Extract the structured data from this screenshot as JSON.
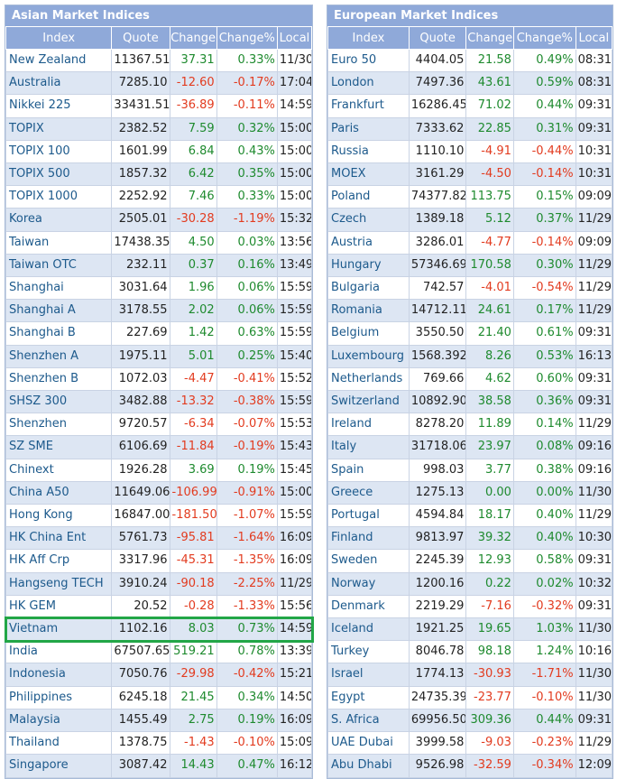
{
  "asian": {
    "title": "Asian Market Indices",
    "headers": [
      "Index",
      "Quote",
      "Change",
      "Change%",
      "Local"
    ],
    "rows": [
      [
        "New Zealand",
        "11367.51",
        "37.31",
        "0.33%",
        "11/30"
      ],
      [
        "Australia",
        "7285.10",
        "-12.60",
        "-0.17%",
        "17:04"
      ],
      [
        "Nikkei 225",
        "33431.51",
        "-36.89",
        "-0.11%",
        "14:59"
      ],
      [
        "TOPIX",
        "2382.52",
        "7.59",
        "0.32%",
        "15:00"
      ],
      [
        "TOPIX 100",
        "1601.99",
        "6.84",
        "0.43%",
        "15:00"
      ],
      [
        "TOPIX 500",
        "1857.32",
        "6.42",
        "0.35%",
        "15:00"
      ],
      [
        "TOPIX 1000",
        "2252.92",
        "7.46",
        "0.33%",
        "15:00"
      ],
      [
        "Korea",
        "2505.01",
        "-30.28",
        "-1.19%",
        "15:32"
      ],
      [
        "Taiwan",
        "17438.35",
        "4.50",
        "0.03%",
        "13:56"
      ],
      [
        "Taiwan OTC",
        "232.11",
        "0.37",
        "0.16%",
        "13:49"
      ],
      [
        "Shanghai",
        "3031.64",
        "1.96",
        "0.06%",
        "15:59"
      ],
      [
        "Shanghai A",
        "3178.55",
        "2.02",
        "0.06%",
        "15:59"
      ],
      [
        "Shanghai B",
        "227.69",
        "1.42",
        "0.63%",
        "15:59"
      ],
      [
        "Shenzhen A",
        "1975.11",
        "5.01",
        "0.25%",
        "15:40"
      ],
      [
        "Shenzhen B",
        "1072.03",
        "-4.47",
        "-0.41%",
        "15:52"
      ],
      [
        "SHSZ 300",
        "3482.88",
        "-13.32",
        "-0.38%",
        "15:59"
      ],
      [
        "Shenzhen",
        "9720.57",
        "-6.34",
        "-0.07%",
        "15:53"
      ],
      [
        "SZ SME",
        "6106.69",
        "-11.84",
        "-0.19%",
        "15:43"
      ],
      [
        "Chinext",
        "1926.28",
        "3.69",
        "0.19%",
        "15:45"
      ],
      [
        "China A50",
        "11649.06",
        "-106.99",
        "-0.91%",
        "15:00"
      ],
      [
        "Hong Kong",
        "16847.00",
        "-181.50",
        "-1.07%",
        "15:59"
      ],
      [
        "HK China Ent",
        "5761.73",
        "-95.81",
        "-1.64%",
        "16:09"
      ],
      [
        "HK Aff Crp",
        "3317.96",
        "-45.31",
        "-1.35%",
        "16:09"
      ],
      [
        "Hangseng TECH",
        "3910.24",
        "-90.18",
        "-2.25%",
        "11/29"
      ],
      [
        "HK GEM",
        "20.52",
        "-0.28",
        "-1.33%",
        "15:56"
      ],
      [
        "Vietnam",
        "1102.16",
        "8.03",
        "0.73%",
        "14:59"
      ],
      [
        "India",
        "67507.65",
        "519.21",
        "0.78%",
        "13:39"
      ],
      [
        "Indonesia",
        "7050.76",
        "-29.98",
        "-0.42%",
        "15:21"
      ],
      [
        "Philippines",
        "6245.18",
        "21.45",
        "0.34%",
        "14:50"
      ],
      [
        "Malaysia",
        "1455.49",
        "2.75",
        "0.19%",
        "16:09"
      ],
      [
        "Thailand",
        "1378.75",
        "-1.43",
        "-0.10%",
        "15:09"
      ],
      [
        "Singapore",
        "3087.42",
        "14.43",
        "0.47%",
        "16:12"
      ]
    ]
  },
  "european": {
    "title": "European Market Indices",
    "headers": [
      "Index",
      "Quote",
      "Change",
      "Change%",
      "Local"
    ],
    "rows": [
      [
        "Euro 50",
        "4404.05",
        "21.58",
        "0.49%",
        "08:31"
      ],
      [
        "London",
        "7497.36",
        "43.61",
        "0.59%",
        "08:31"
      ],
      [
        "Frankfurt",
        "16286.45",
        "71.02",
        "0.44%",
        "09:31"
      ],
      [
        "Paris",
        "7333.62",
        "22.85",
        "0.31%",
        "09:31"
      ],
      [
        "Russia",
        "1110.10",
        "-4.91",
        "-0.44%",
        "10:31"
      ],
      [
        "MOEX",
        "3161.29",
        "-4.50",
        "-0.14%",
        "10:31"
      ],
      [
        "Poland",
        "74377.82",
        "113.75",
        "0.15%",
        "09:09"
      ],
      [
        "Czech",
        "1389.18",
        "5.12",
        "0.37%",
        "11/29"
      ],
      [
        "Austria",
        "3286.01",
        "-4.77",
        "-0.14%",
        "09:09"
      ],
      [
        "Hungary",
        "57346.69",
        "170.58",
        "0.30%",
        "11/29"
      ],
      [
        "Bulgaria",
        "742.57",
        "-4.01",
        "-0.54%",
        "11/29"
      ],
      [
        "Romania",
        "14712.11",
        "24.61",
        "0.17%",
        "11/29"
      ],
      [
        "Belgium",
        "3550.50",
        "21.40",
        "0.61%",
        "09:31"
      ],
      [
        "Luxembourg",
        "1568.392",
        "8.26",
        "0.53%",
        "16:13"
      ],
      [
        "Netherlands",
        "769.66",
        "4.62",
        "0.60%",
        "09:31"
      ],
      [
        "Switzerland",
        "10892.90",
        "38.58",
        "0.36%",
        "09:31"
      ],
      [
        "Ireland",
        "8278.20",
        "11.89",
        "0.14%",
        "11/29"
      ],
      [
        "Italy",
        "31718.06",
        "23.97",
        "0.08%",
        "09:16"
      ],
      [
        "Spain",
        "998.03",
        "3.77",
        "0.38%",
        "09:16"
      ],
      [
        "Greece",
        "1275.13",
        "0.00",
        "0.00%",
        "11/30"
      ],
      [
        "Portugal",
        "4594.84",
        "18.17",
        "0.40%",
        "11/29"
      ],
      [
        "Finland",
        "9813.97",
        "39.32",
        "0.40%",
        "10:30"
      ],
      [
        "Sweden",
        "2245.39",
        "12.93",
        "0.58%",
        "09:31"
      ],
      [
        "Norway",
        "1200.16",
        "0.22",
        "0.02%",
        "10:32"
      ],
      [
        "Denmark",
        "2219.29",
        "-7.16",
        "-0.32%",
        "09:31"
      ],
      [
        "Iceland",
        "1921.25",
        "19.65",
        "1.03%",
        "11/30"
      ],
      [
        "Turkey",
        "8046.78",
        "98.18",
        "1.24%",
        "10:16"
      ],
      [
        "Israel",
        "1774.13",
        "-30.93",
        "-1.71%",
        "11/30"
      ],
      [
        "Egypt",
        "24735.39",
        "-23.77",
        "-0.10%",
        "11/30"
      ],
      [
        "S. Africa",
        "69956.50",
        "309.36",
        "0.44%",
        "09:31"
      ],
      [
        "UAE Dubai",
        "3999.58",
        "-9.03",
        "-0.23%",
        "11/29"
      ],
      [
        "Abu Dhabi",
        "9526.98",
        "-32.59",
        "-0.34%",
        "12:09"
      ]
    ]
  },
  "highlight_row": "Vietnam",
  "colors": {
    "header": "#8fa9d9",
    "row_alt": "#dde6f3",
    "positive": "#1e8a2e",
    "negative": "#e23b1f",
    "highlight": "#22a647",
    "index_link": "#1d5a8c"
  }
}
